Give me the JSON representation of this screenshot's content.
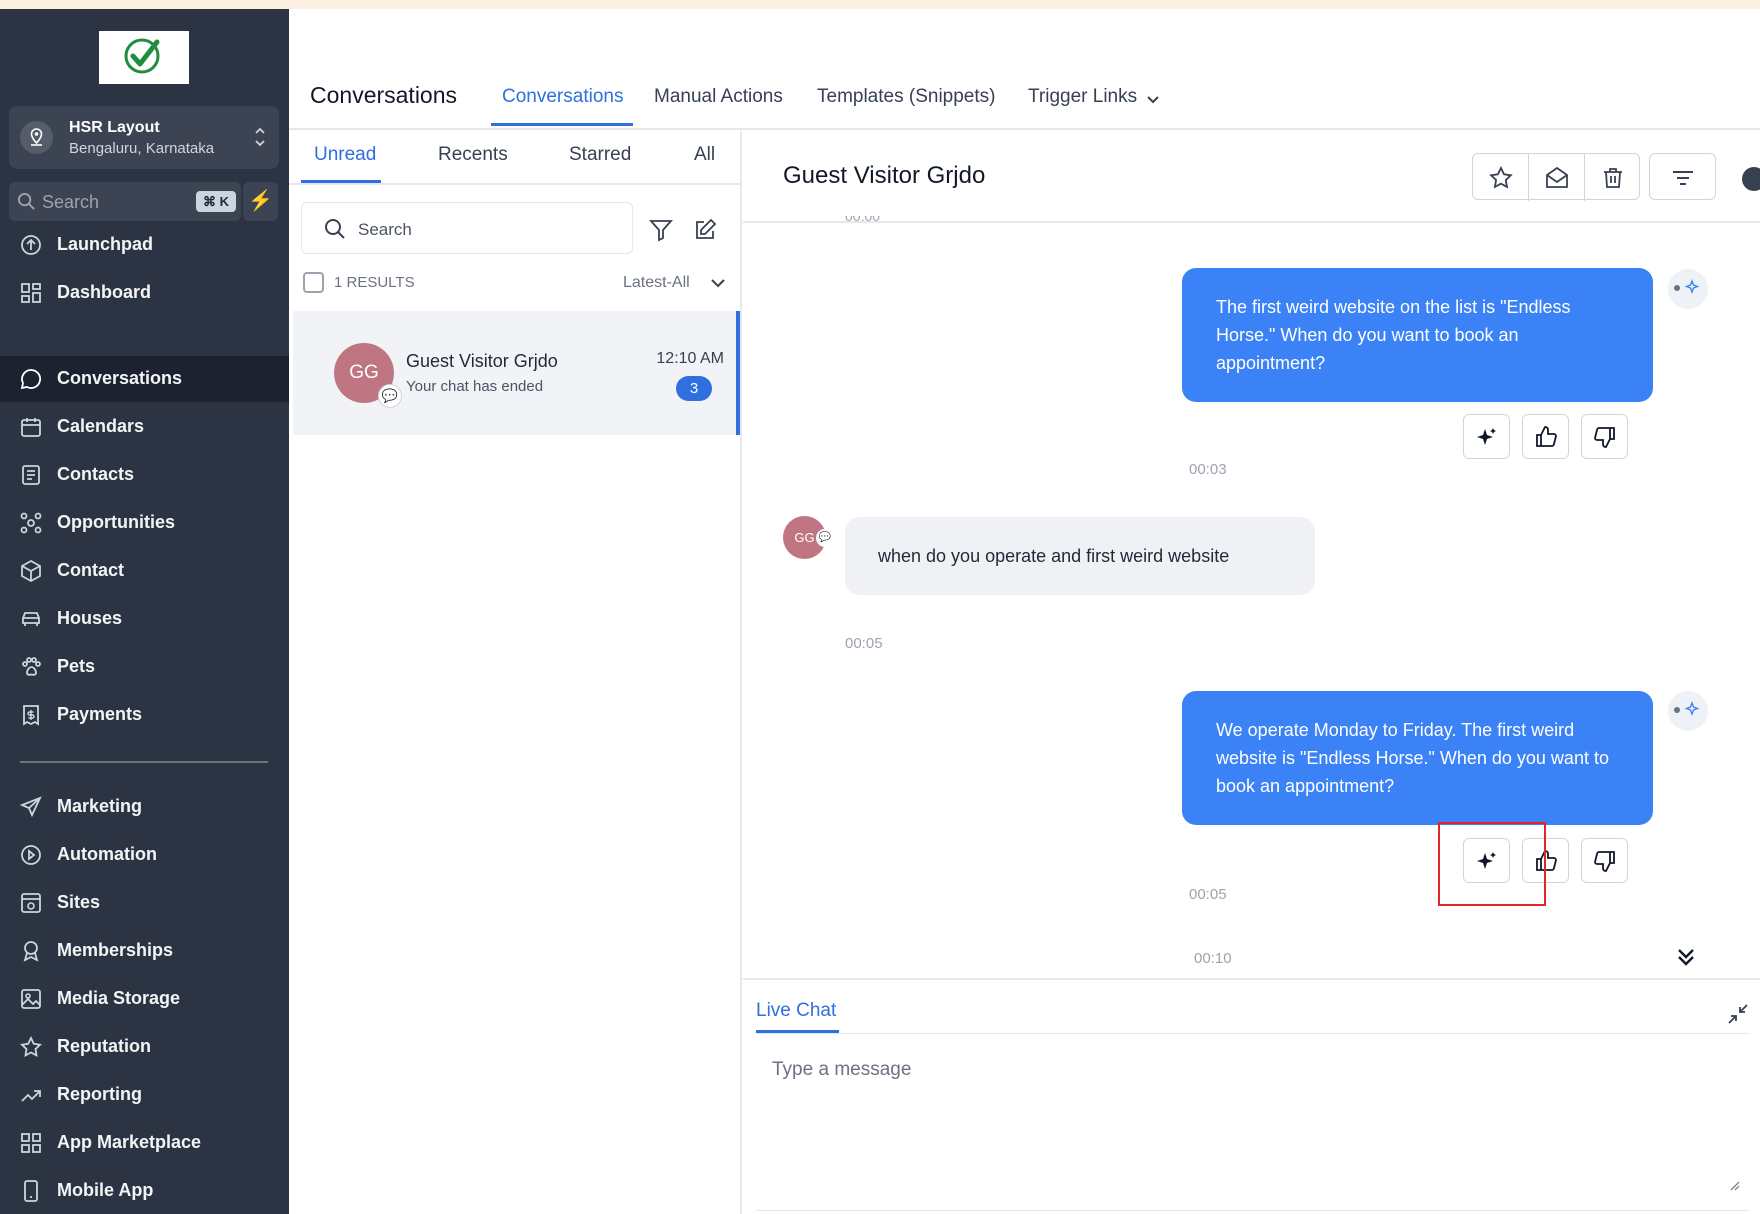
{
  "sidebar": {
    "location_name": "HSR Layout",
    "location_sub": "Bengaluru, Karnataka",
    "search_placeholder": "Search",
    "search_shortcut": "⌘ K",
    "items": [
      {
        "label": "Launchpad",
        "icon": "launchpad-icon"
      },
      {
        "label": "Dashboard",
        "icon": "dashboard-icon"
      },
      {
        "label": "Conversations",
        "icon": "chat-icon",
        "active": true
      },
      {
        "label": "Calendars",
        "icon": "calendar-icon"
      },
      {
        "label": "Contacts",
        "icon": "contacts-icon"
      },
      {
        "label": "Opportunities",
        "icon": "opportunities-icon"
      },
      {
        "label": "Contact",
        "icon": "box-icon"
      },
      {
        "label": "Houses",
        "icon": "car-icon"
      },
      {
        "label": "Pets",
        "icon": "paw-icon"
      },
      {
        "label": "Payments",
        "icon": "payments-icon"
      }
    ],
    "items2": [
      {
        "label": "Marketing",
        "icon": "send-icon"
      },
      {
        "label": "Automation",
        "icon": "automation-icon"
      },
      {
        "label": "Sites",
        "icon": "sites-icon"
      },
      {
        "label": "Memberships",
        "icon": "badge-icon"
      },
      {
        "label": "Media Storage",
        "icon": "image-icon"
      },
      {
        "label": "Reputation",
        "icon": "star-icon"
      },
      {
        "label": "Reporting",
        "icon": "trend-icon"
      },
      {
        "label": "App Marketplace",
        "icon": "grid-icon"
      },
      {
        "label": "Mobile App",
        "icon": "phone-icon"
      }
    ]
  },
  "header": {
    "title": "Conversations",
    "tabs": [
      "Conversations",
      "Manual Actions",
      "Templates (Snippets)",
      "Trigger Links"
    ]
  },
  "list": {
    "tabs": [
      "Unread",
      "Recents",
      "Starred",
      "All"
    ],
    "search_placeholder": "Search",
    "results": "1 RESULTS",
    "sort": "Latest-All",
    "item": {
      "initials": "GG",
      "name": "Guest Visitor Grjdo",
      "preview": "Your chat has ended",
      "time": "12:10 AM",
      "unread": "3"
    }
  },
  "chat": {
    "title": "Guest Visitor Grjdo",
    "messages": [
      {
        "dir": "out",
        "text": "The first weird website on the list is \"Endless Horse.\" When do you want to book an appointment?",
        "time": "00:03"
      },
      {
        "dir": "in",
        "initials": "GG",
        "text": "when do you operate and first weird website",
        "time": "00:05"
      },
      {
        "dir": "out",
        "text": "We operate Monday to Friday. The first weird website is \"Endless Horse.\" When do you want to book an appointment?",
        "time": "00:05"
      }
    ],
    "last_time": "00:10",
    "composer_tab": "Live Chat",
    "composer_placeholder": "Type a message"
  },
  "colors": {
    "accent": "#2f6fe0",
    "bubble": "#3b82f6",
    "sidebar": "#2c3342",
    "highlight": "#e0252b"
  }
}
